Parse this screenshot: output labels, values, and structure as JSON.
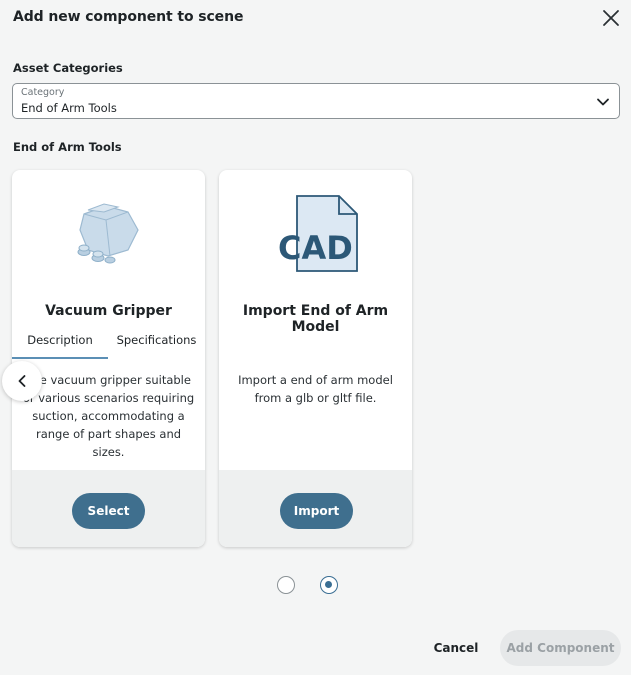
{
  "dialog": {
    "title": "Add new component to scene"
  },
  "asset_categories": {
    "heading": "Asset Categories",
    "select": {
      "label": "Category",
      "value": "End of Arm Tools"
    }
  },
  "section_heading": "End of Arm Tools",
  "cards": [
    {
      "name": "Vacuum Gripper",
      "tabs": [
        "Description",
        "Specifications"
      ],
      "active_tab": "Description",
      "description_lines": [
        "ible vacuum gripper suitable",
        "or various scenarios requiring",
        "suction, accommodating a",
        "range of part shapes and sizes."
      ],
      "button": "Select",
      "icon": "vacuum-gripper-icon"
    },
    {
      "name": "Import End of Arm Model",
      "cad_text": "CAD",
      "description_lines": [
        "Import a end of arm model",
        "from a glb or gltf file."
      ],
      "button": "Import",
      "icon": "cad-file-icon"
    }
  ],
  "pagination": {
    "pages": 2,
    "active_page": 2
  },
  "footer": {
    "cancel": "Cancel",
    "add_component": "Add Component"
  },
  "colors": {
    "primary": "#3f6f8e",
    "background": "#f4f5f5",
    "tab_underline": "#5b8fb5",
    "disabled": "#e6e8e9"
  }
}
